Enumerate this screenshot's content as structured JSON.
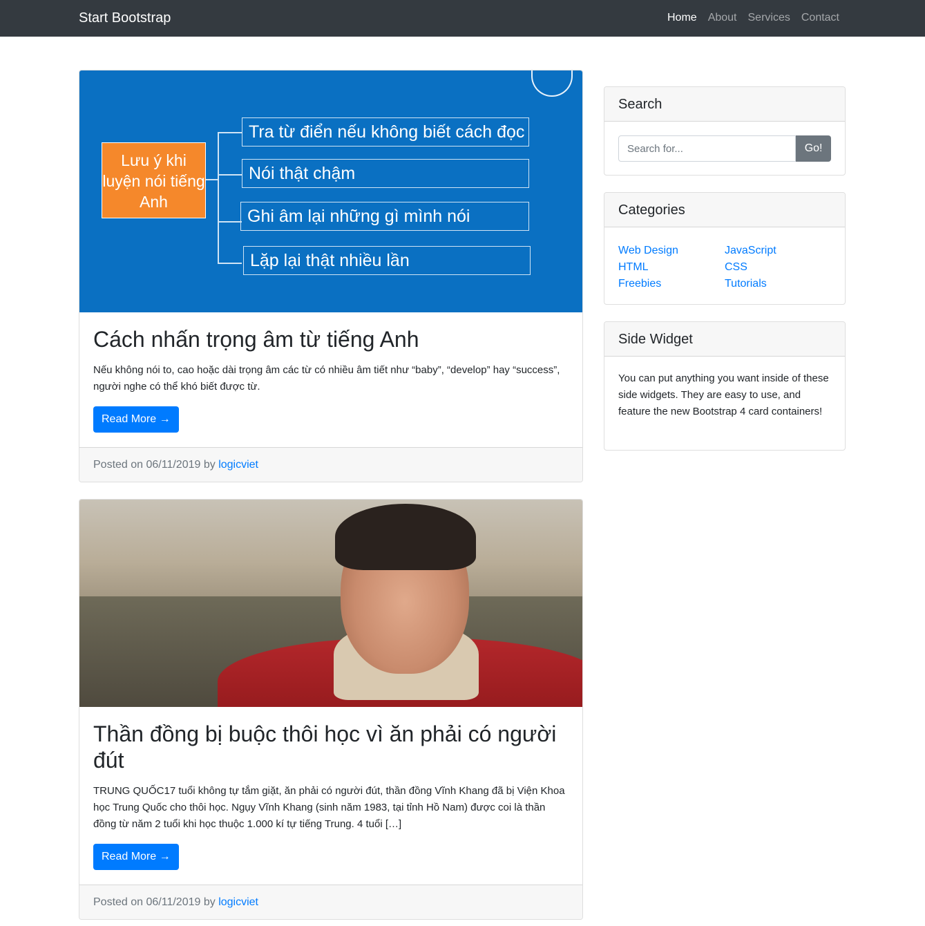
{
  "navbar": {
    "brand": "Start Bootstrap",
    "links": [
      "Home",
      "About",
      "Services",
      "Contact"
    ],
    "active_index": 0
  },
  "posts": [
    {
      "title": "Cách nhấn trọng âm từ tiếng Anh",
      "excerpt": "Nếu không nói to, cao hoặc dài trọng âm các từ có nhiều âm tiết như “baby”, “develop” hay “success”, người nghe có thể khó biết được từ.",
      "read_more": "Read More →",
      "footer_prefix": "Posted on 06/11/2019 by ",
      "author": "logicviet",
      "image": {
        "main_label": "Lưu ý khi luyện nói tiếng Anh",
        "items": [
          "Tra từ điển nếu không biết cách đọc",
          "Nói thật chậm",
          "Ghi âm lại những gì mình nói",
          "Lặp lại thật nhiều lần"
        ]
      }
    },
    {
      "title": "Thần đồng bị buộc thôi học vì ăn phải có người đút",
      "excerpt": "TRUNG QUỐC17 tuổi không tự tắm giặt, ăn phải có người đút, thần đồng Vĩnh Khang đã bị Viện Khoa học Trung Quốc cho thôi học. Ngụy Vĩnh Khang (sinh năm 1983, tại tỉnh Hồ Nam) được coi là thần đồng từ năm 2 tuổi khi học thuộc 1.000 kí tự tiếng Trung. 4 tuổi […]",
      "read_more": "Read More →",
      "footer_prefix": "Posted on 06/11/2019 by ",
      "author": "logicviet"
    }
  ],
  "sidebar": {
    "search": {
      "title": "Search",
      "placeholder": "Search for...",
      "button": "Go!"
    },
    "categories": {
      "title": "Categories",
      "col1": [
        "Web Design",
        "HTML",
        "Freebies"
      ],
      "col2": [
        "JavaScript",
        "CSS",
        "Tutorials"
      ]
    },
    "widget": {
      "title": "Side Widget",
      "text": "You can put anything you want inside of these side widgets. They are easy to use, and feature the new Bootstrap 4 card containers!"
    }
  },
  "colors": {
    "navbar_bg": "#343a40",
    "primary": "#007bff",
    "secondary": "#6c757d",
    "image_blue": "#0a70c2",
    "image_orange": "#f5882b"
  }
}
